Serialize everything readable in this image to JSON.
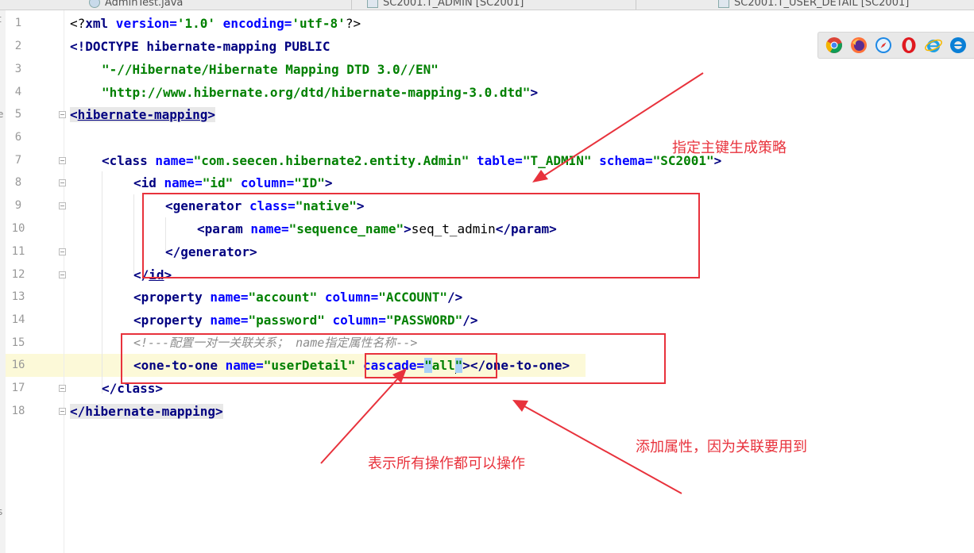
{
  "tabs": [
    {
      "label": "AdminTest.java",
      "icon": "java-file-icon"
    },
    {
      "label": "SC2001.T_ADMIN [SC2001]",
      "icon": "table-icon"
    },
    {
      "label": "SC2001.T_USER_DETAIL [SC2001]",
      "icon": "table-icon"
    }
  ],
  "left_strip": [
    "t",
    "e",
    "s"
  ],
  "line_numbers": [
    "1",
    "2",
    "3",
    "4",
    "5",
    "6",
    "7",
    "8",
    "9",
    "10",
    "11",
    "12",
    "13",
    "14",
    "15",
    "16",
    "17",
    "18"
  ],
  "code": {
    "l1": {
      "open": "<?",
      "tag": "xml",
      "a1": " version=",
      "v1": "'1.0'",
      "a2": " encoding=",
      "v2": "'utf-8'",
      "close": "?>"
    },
    "l2": {
      "tag": "<!DOCTYPE hibernate-mapping PUBLIC"
    },
    "l3": {
      "str": "\"-//Hibernate/Hibernate Mapping DTD 3.0//EN\""
    },
    "l4": {
      "str": "\"http://www.hibernate.org/dtd/hibernate-mapping-3.0.dtd\"",
      "close": ">"
    },
    "l5": {
      "lt": "<",
      "tag": "hibernate-mapping",
      "gt": ">"
    },
    "l7": {
      "tag": "<class",
      "a1": " name=",
      "v1": "\"com.seecen.hibernate2.entity.Admin\"",
      "a2": " table=",
      "v2": "\"T_ADMIN\"",
      "a3": " schema=",
      "v3": "\"SC2001\"",
      "close": ">"
    },
    "l8": {
      "tag": "<id",
      "a1": " name=",
      "v1": "\"id\"",
      "a2": " column=",
      "v2": "\"ID\"",
      "close": ">"
    },
    "l9": {
      "tag": "<generator",
      "a1": " class=",
      "v1": "\"native\"",
      "close": ">"
    },
    "l10": {
      "tag": "<param",
      "a1": " name=",
      "v1": "\"sequence_name\"",
      "gt": ">",
      "text": "seq_t_admin",
      "end": "</param>"
    },
    "l11": {
      "tag": "</generator>"
    },
    "l12": {
      "tag_lt": "</",
      "tag": "id",
      "gt": ">"
    },
    "l13": {
      "tag": "<property",
      "a1": " name=",
      "v1": "\"account\"",
      "a2": " column=",
      "v2": "\"ACCOUNT\"",
      "close": "/>"
    },
    "l14": {
      "tag": "<property",
      "a1": " name=",
      "v1": "\"password\"",
      "a2": " column=",
      "v2": "\"PASSWORD\"",
      "close": "/>"
    },
    "l15": {
      "comment": "<!---配置一对一关联关系； name指定属性名称-->"
    },
    "l16": {
      "tag": "<one-to-one",
      "a1": " name=",
      "v1": "\"userDetail\"",
      "a2": "cascade=",
      "q1": "\"",
      "v2": "all",
      "q2": "\"",
      "gt": ">",
      "lt2": "</",
      "end": "one-to-one>"
    },
    "l17": {
      "tag": "</class>"
    },
    "l18": {
      "tag": "</hibernate-mapping>"
    }
  },
  "browser_icons": [
    "chrome-icon",
    "firefox-icon",
    "safari-icon",
    "opera-icon",
    "ie-icon",
    "edge-icon"
  ],
  "annotations": {
    "generator_note": "指定主键生成策略",
    "cascade_note": "表示所有操作都可以操作",
    "property_note": "添加属性，因为关联要用到"
  },
  "colors": {
    "annotation_red": "#e8323c",
    "tag": "#000080",
    "attr": "#0000ff",
    "value": "#008000",
    "comment": "#8c8c8c"
  }
}
